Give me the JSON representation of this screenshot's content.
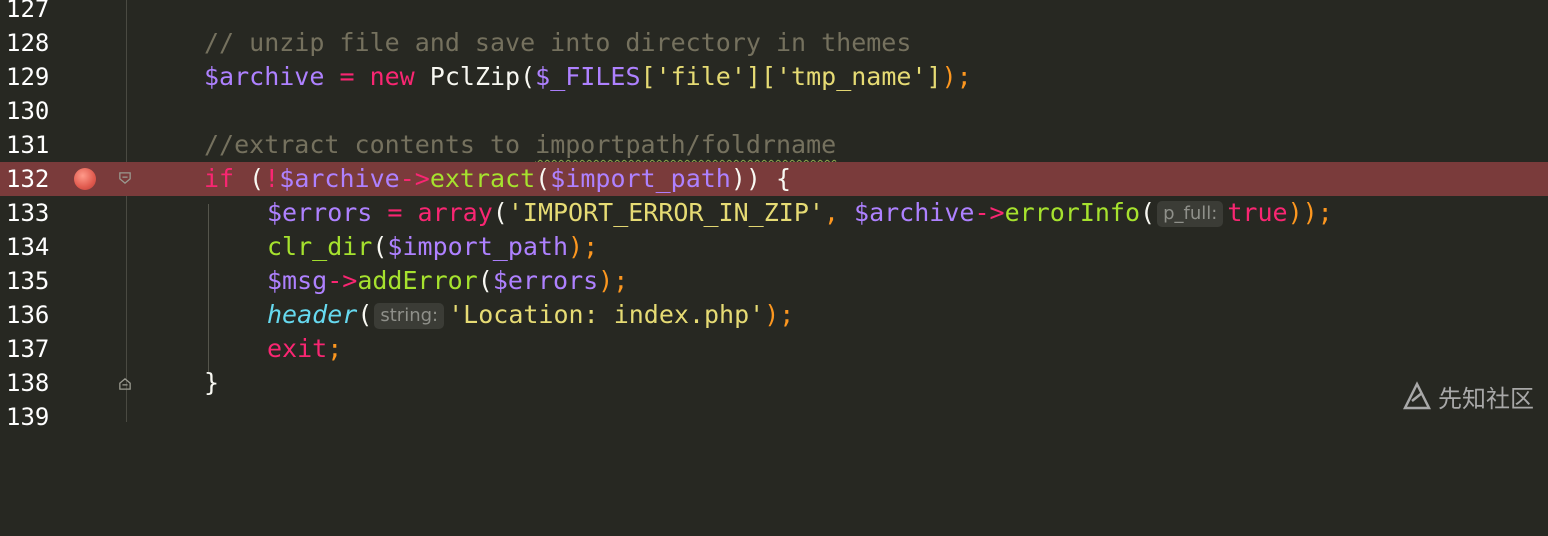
{
  "editor": {
    "lines": [
      {
        "num": "127"
      },
      {
        "num": "128",
        "comment": "// unzip file and save into directory in themes"
      },
      {
        "num": "129",
        "var1": "$archive",
        "eq": " = ",
        "kw": "new",
        "cls": " PclZip(",
        "var2": "$_FILES",
        "s1": "['file']",
        "s2": "['tmp_name']",
        "end": ");"
      },
      {
        "num": "130"
      },
      {
        "num": "131",
        "comment_a": "//extract contents to ",
        "comment_b": "importpath/foldrname"
      },
      {
        "num": "132",
        "kw": "if",
        "p1": " (",
        "neg": "!",
        "var": "$archive",
        "arrow": "->",
        "fn": "extract",
        "p2": "(",
        "var2": "$import_path",
        "p3": ")) {"
      },
      {
        "num": "133",
        "var": "$errors",
        "eq": " = ",
        "fn": "array",
        "p1": "(",
        "str": "'IMPORT_ERROR_IN_ZIP'",
        "comma": ", ",
        "var2": "$archive",
        "arrow": "->",
        "fn2": "errorInfo",
        "p2": "(",
        "hint": "p_full:",
        "kw": "true",
        "end": "));"
      },
      {
        "num": "134",
        "fn": "clr_dir",
        "p1": "(",
        "var": "$import_path",
        "end": ");"
      },
      {
        "num": "135",
        "var": "$msg",
        "arrow": "->",
        "fn": "addError",
        "p1": "(",
        "var2": "$errors",
        "end": ");"
      },
      {
        "num": "136",
        "fn": "header",
        "p1": "(",
        "hint": "string:",
        "str": "'Location: index.php'",
        "end": ");"
      },
      {
        "num": "137",
        "kw": "exit",
        "end": ";"
      },
      {
        "num": "138",
        "brace": "}"
      },
      {
        "num": "139"
      }
    ]
  },
  "watermark": {
    "text": "先知社区"
  }
}
